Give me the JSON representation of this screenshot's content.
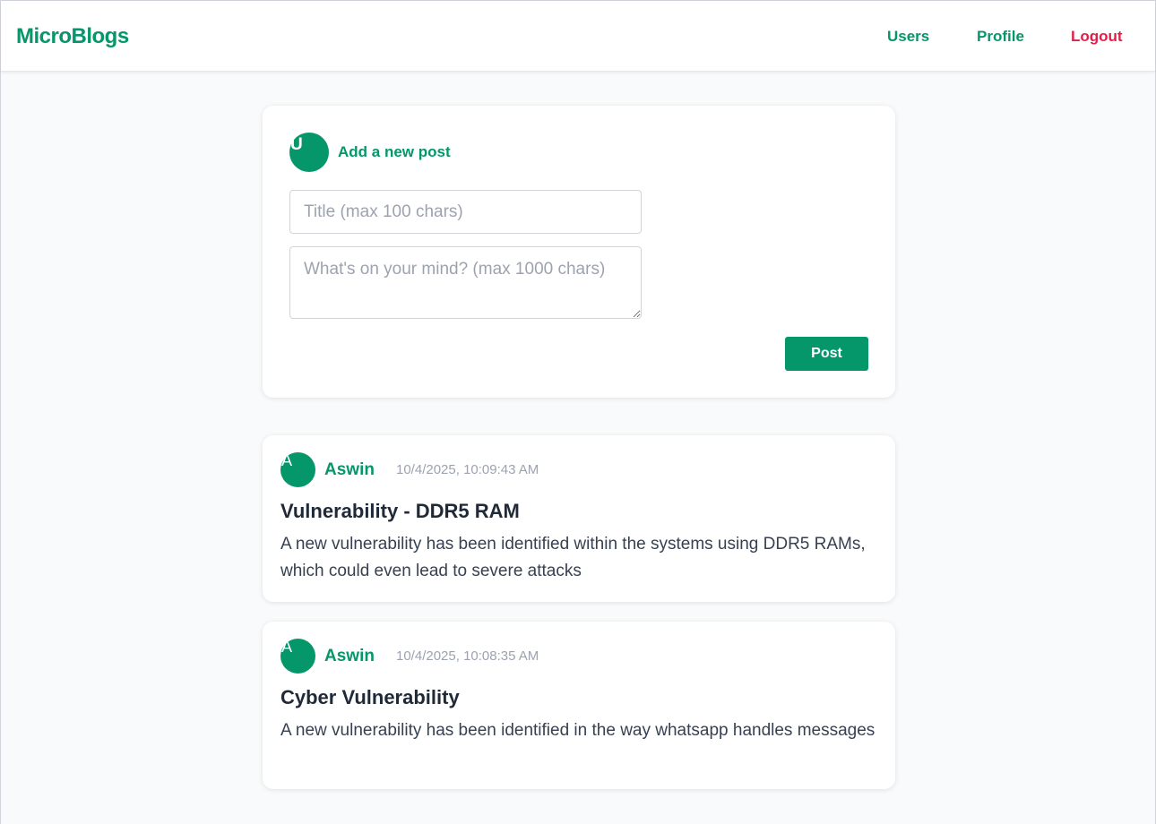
{
  "header": {
    "brand": "MicroBlogs",
    "nav": {
      "users": "Users",
      "profile": "Profile",
      "logout": "Logout"
    }
  },
  "composer": {
    "avatar_letter": "U",
    "heading": "Add a new post",
    "title_placeholder": "Title (max 100 chars)",
    "body_placeholder": "What's on your mind? (max 1000 chars)",
    "post_label": "Post"
  },
  "posts": [
    {
      "avatar_letter": "A",
      "author": "Aswin",
      "timestamp": "10/4/2025, 10:09:43 AM",
      "title": "Vulnerability - DDR5 RAM",
      "body": "A new vulnerability has been identified within the systems using DDR5 RAMs, which could even lead to severe attacks"
    },
    {
      "avatar_letter": "A",
      "author": "Aswin",
      "timestamp": "10/4/2025, 10:08:35 AM",
      "title": "Cyber Vulnerability",
      "body": "A new vulnerability has been identified in the way whatsapp handles messages"
    }
  ],
  "colors": {
    "brand": "#059669",
    "logout": "#e11d48",
    "background": "#f9fafb"
  }
}
